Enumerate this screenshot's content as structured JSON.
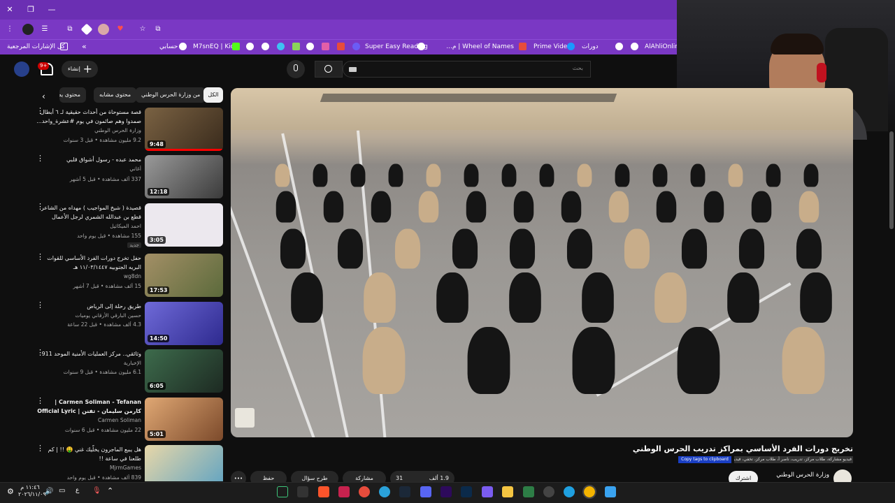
{
  "browser": {
    "window_controls": [
      "✕",
      "❐",
      "—"
    ],
    "bookmarks": [
      {
        "label": "كل الإشارات المرجعية"
      },
      {
        "label": "حسابي"
      },
      {
        "label": "M7snEQ | Kick"
      },
      {
        "label": "Super Easy Reading"
      },
      {
        "label": "Wheel of Names | م..."
      },
      {
        "label": "Prime Video"
      },
      {
        "label": "دورات"
      },
      {
        "label": "AlAhliOnline"
      }
    ],
    "overflow_chevron": "»"
  },
  "youtube": {
    "search_placeholder": "بحث",
    "create_label": "إنشاء",
    "notification_count": "9+",
    "chips": [
      {
        "label": "الكل",
        "active": true
      },
      {
        "label": "من وزارة الحرس الوطني",
        "active": false
      },
      {
        "label": "محتوى مشابه",
        "active": false
      },
      {
        "label": "محتوى يه",
        "active": false
      }
    ],
    "recommendations": [
      {
        "title": "قصة مستوحاة من أحداث حقيقية لـ ٦ أبطال صمدوا وهم صائمون في يوم #عشرة_واحد...",
        "channel": "وزارة الحرس الوطني",
        "verified": true,
        "meta": "9.2 مليون مشاهدة • قبل 3 سنوات",
        "duration": "9:48",
        "progress": 1.0,
        "badge": "",
        "thumb": "#5a4630"
      },
      {
        "title": "محمد عبده - رسول أشواق قلبي",
        "channel": "أغاني",
        "verified": false,
        "meta": "337 ألف مشاهدة • قبل 5 أشهر",
        "duration": "12:18",
        "progress": 0,
        "badge": "",
        "thumb": "#6e6e6e"
      },
      {
        "title": "قصيدة ( شيخ المواجيب ) مهداه من الشاعر قطع بن عبدالله الشمري لرجل الأعمال احمـ...",
        "channel": "احمد الميكائيل",
        "verified": false,
        "meta": "155 مشاهدة • قبل يوم واحد",
        "duration": "3:05",
        "progress": 0,
        "badge": "جديد",
        "thumb": "#e9e6ea"
      },
      {
        "title": "حفل تخرج دورات الفرد الأساسي للقوات البريه الجنوبيه ١١/٠٣/١٤٤٧ هـ",
        "channel": "wg8dn",
        "verified": false,
        "meta": "15 ألف مشاهدة • قبل 7 أشهر",
        "duration": "17:53",
        "progress": 0,
        "badge": "",
        "thumb": "#8c7a55"
      },
      {
        "title": "طريق رحلة إلى الرياض",
        "channel": "حسين البارقي الأرقاني يوميات",
        "verified": false,
        "meta": "4.3 ألف مشاهدة • قبل 22 ساعة",
        "duration": "14:50",
        "progress": 0,
        "badge": "",
        "thumb": "#5b56c8"
      },
      {
        "title": "وثائقي.. مركز العمليات الأمنية الموحد 911",
        "channel": "الإخبارية",
        "verified": true,
        "meta": "6.1 مليون مشاهدة • قبل 9 سنوات",
        "duration": "6:05",
        "progress": 0,
        "badge": "",
        "thumb": "#2f4d3a"
      },
      {
        "title": "Carmen Soliman - Tefanan | كارمن سليمان - تفنن | Official Lyric Video",
        "channel": "Carmen Soliman",
        "verified": true,
        "meta": "22 مليون مشاهدة • قبل 6 سنوات",
        "duration": "5:01",
        "progress": 0,
        "badge": "",
        "thumb": "#c88a5e"
      },
      {
        "title": "هل يبيع الماجرون يخلّيك غني 🤑 !! | كم طلعنا في ساعة !!",
        "channel": "MjrmGames",
        "verified": true,
        "meta": "839 ألف مشاهدة • قبل يوم واحد",
        "duration": "",
        "progress": 0,
        "badge": "",
        "thumb": "#d9c8a2"
      }
    ],
    "video": {
      "title": "تخريج دورات الفرد الأساسي بمراكز تدريب الحرس الوطني",
      "tags": "فيديو مشاركة، طلاب مركز، تدريب، ناصر أ، طلاب مركز، تخفي، فيديو، مبيناك تسجيل",
      "copy_tags": "Copy tags to clipboard",
      "channel": "وزارة الحرس الوطني",
      "subscribe": "اشترك",
      "likes": "1.9 ألف",
      "comments": "31",
      "share": "مشاركة",
      "ask": "طرح سؤال",
      "save": "حفظ",
      "more": "•••"
    }
  },
  "taskbar": {
    "time": "١١:٤٦ م",
    "date": "٢٠٢٦/١١/٠٩",
    "lang": "ع"
  },
  "colors": {
    "browser_purple": "#7a38c4",
    "yt_red": "#ff0000",
    "bg": "#0f0f0f"
  }
}
